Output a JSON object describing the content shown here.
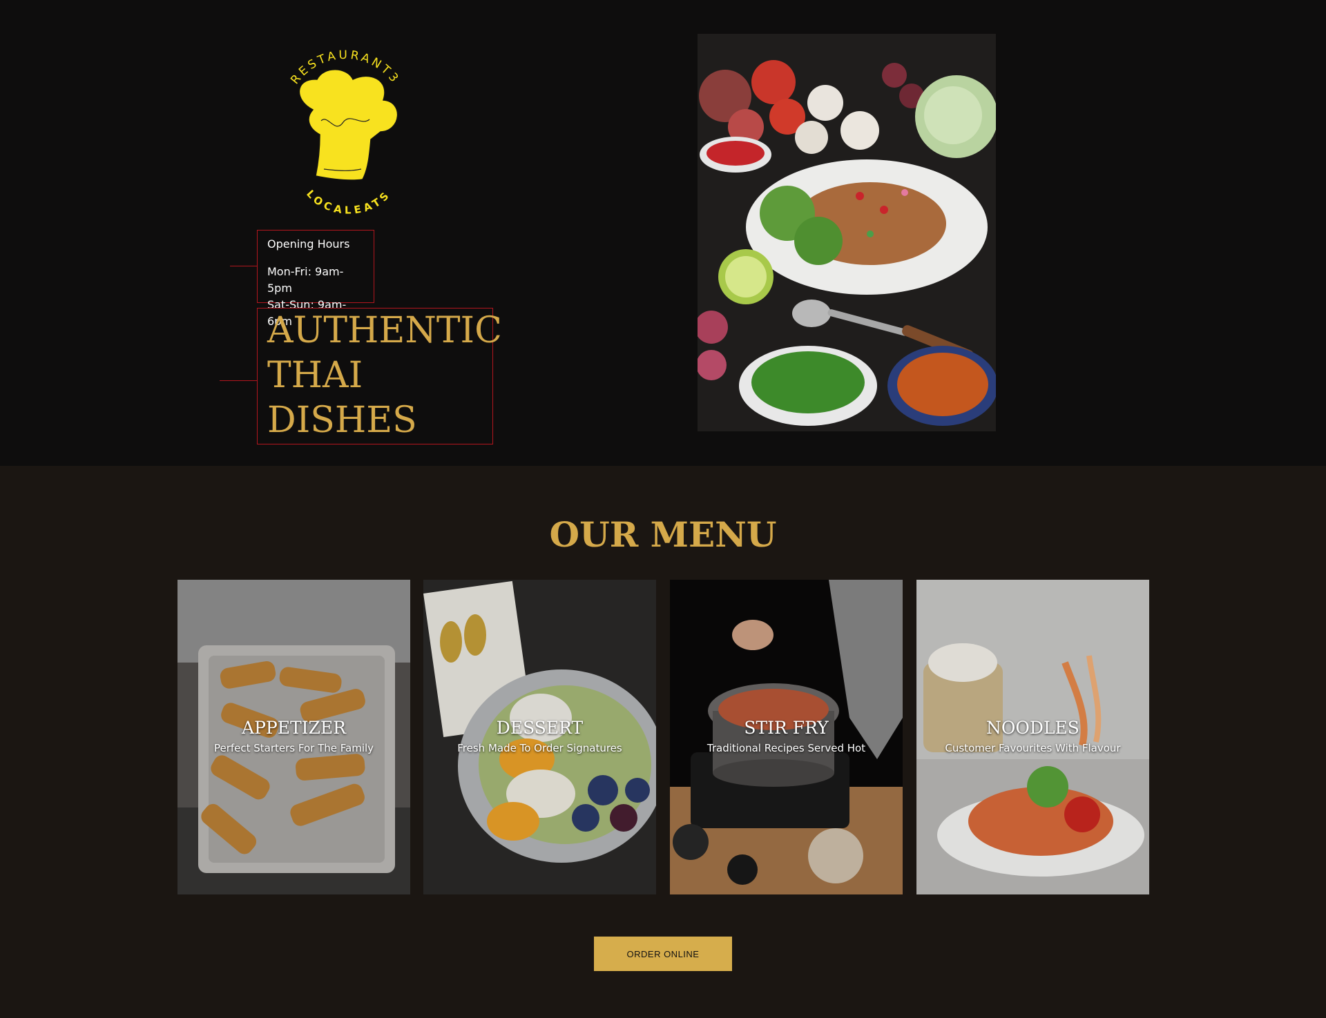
{
  "brand": {
    "arc_text": "RESTAURANT3",
    "name": "LOCALEATS",
    "logo_color": "#f8e21f"
  },
  "hours": {
    "title": "Opening Hours",
    "rows": [
      "Mon-Fri: 9am-5pm",
      "Sat-Sun: 9am-6pm"
    ]
  },
  "hero": {
    "headline": [
      "AUTHENTIC",
      "THAI",
      "DISHES"
    ],
    "photo_icon": "thai-salad-photo"
  },
  "menu": {
    "title": "OUR MENU",
    "cards": [
      {
        "title": "APPETIZER",
        "subtitle": "Perfect Starters For The Family",
        "photo": "spring-rolls-photo"
      },
      {
        "title": "DESSERT",
        "subtitle": "Fresh Made To Order Signatures",
        "photo": "mango-sticky-rice-photo"
      },
      {
        "title": "STIR FRY",
        "subtitle": "Traditional Recipes Served Hot",
        "photo": "cooking-pot-photo"
      },
      {
        "title": "NOODLES",
        "subtitle": "Customer Favourites With Flavour",
        "photo": "papaya-salad-photo"
      }
    ],
    "order_button": "ORDER ONLINE"
  },
  "colors": {
    "accent_gold": "#d5a94a",
    "border_red": "#b3161e",
    "hero_bg": "#0e0d0d",
    "menu_bg": "#1b1612",
    "button_bg": "#d6ad4c"
  }
}
